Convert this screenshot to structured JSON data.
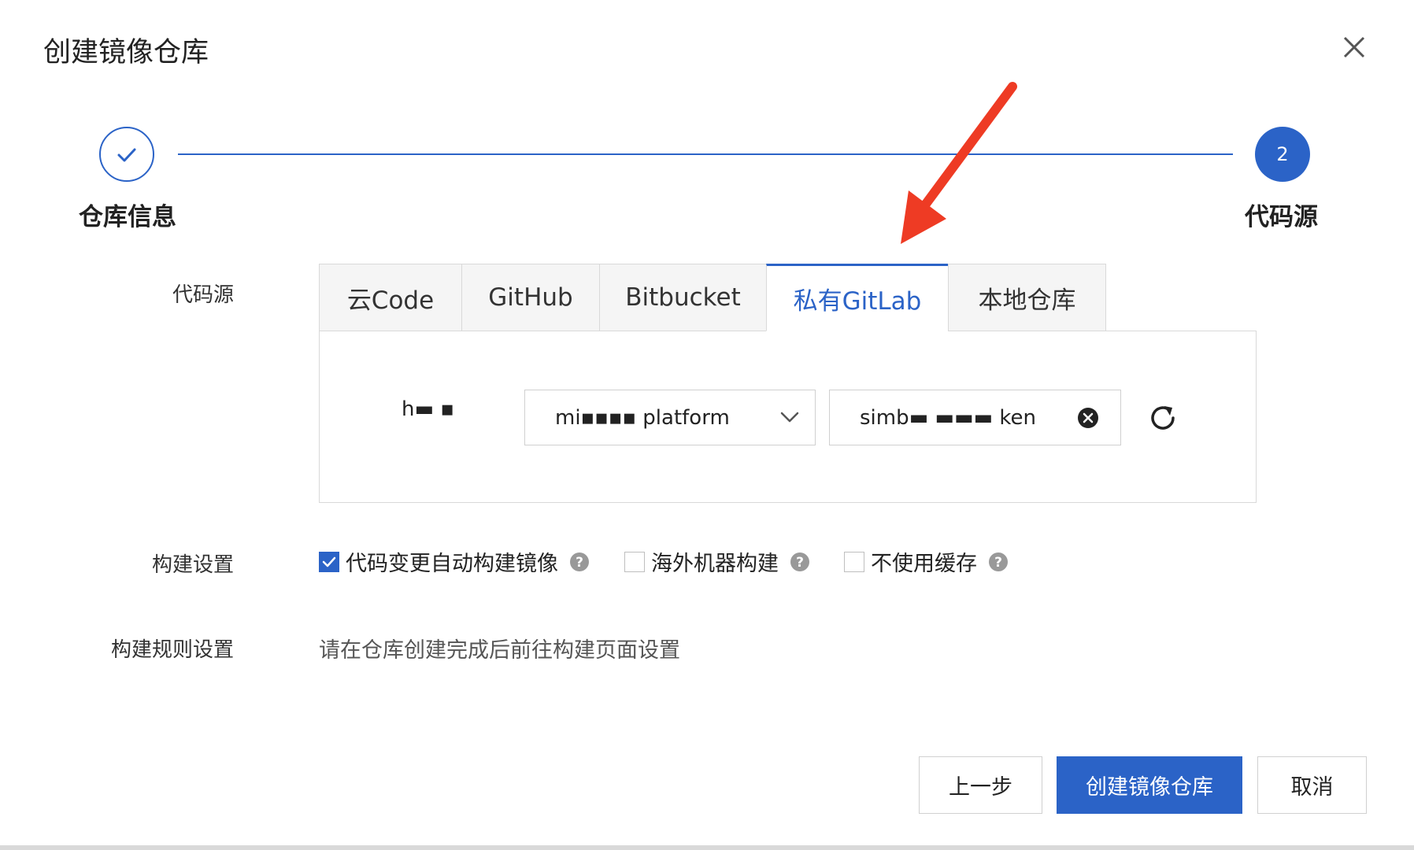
{
  "dialog": {
    "title": "创建镜像仓库",
    "close_icon": "close-icon"
  },
  "stepper": {
    "step1": {
      "label": "仓库信息",
      "icon": "check-icon",
      "state": "completed"
    },
    "step2": {
      "number": "2",
      "label": "代码源",
      "state": "active"
    },
    "accent": "#2b63c7"
  },
  "code_source": {
    "label": "代码源",
    "tabs": [
      {
        "label": "云Code"
      },
      {
        "label": "GitHub"
      },
      {
        "label": "Bitbucket"
      },
      {
        "label": "私有GitLab"
      },
      {
        "label": "本地仓库"
      }
    ],
    "active_tab": "私有GitLab",
    "namespace_text": "h▬ ▪",
    "project_select": {
      "value": "mi▪▪▪▪ platform",
      "icon": "chevron-down-icon"
    },
    "branch_input": {
      "value": "simb▬ ▬▬▬ ken",
      "clear_icon": "clear-circle-icon"
    },
    "refresh_icon": "refresh-icon"
  },
  "build_settings": {
    "label": "构建设置",
    "options": [
      {
        "label": "代码变更自动构建镜像",
        "checked": true
      },
      {
        "label": "海外机器构建",
        "checked": false
      },
      {
        "label": "不使用缓存",
        "checked": false
      }
    ],
    "help_icon": "question-circle-icon"
  },
  "build_rules": {
    "label": "构建规则设置",
    "text": "请在仓库创建完成后前往构建页面设置"
  },
  "footer": {
    "prev_label": "上一步",
    "create_label": "创建镜像仓库",
    "cancel_label": "取消"
  },
  "colors": {
    "primary": "#2b63c7",
    "annotation_arrow": "#ee3b24",
    "border": "#d9d9d9"
  }
}
